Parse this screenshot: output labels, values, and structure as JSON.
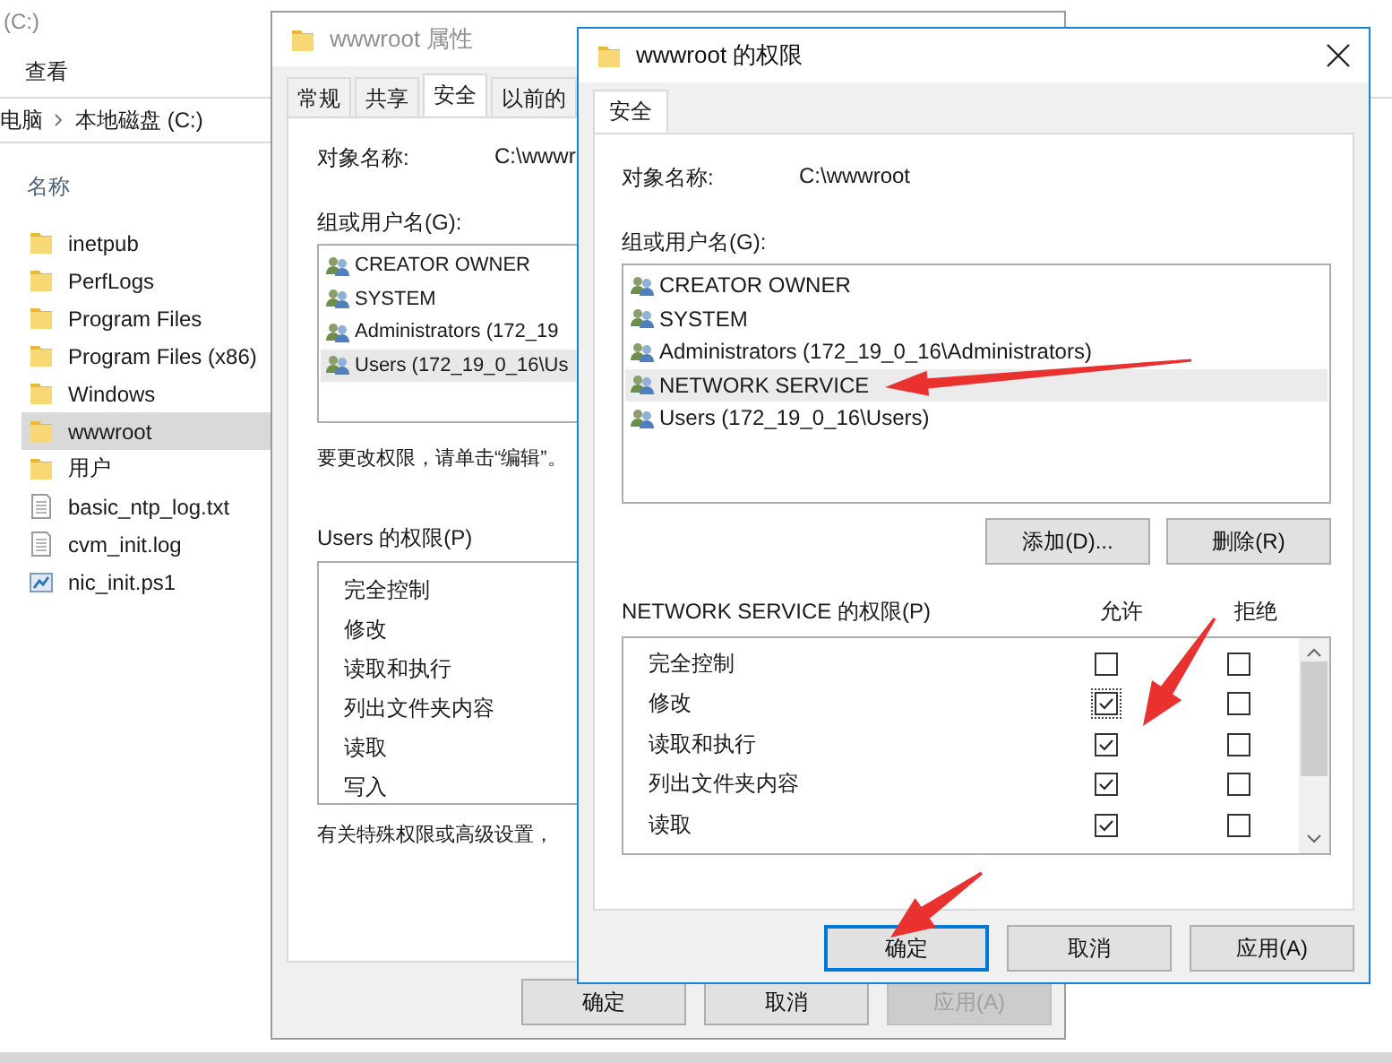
{
  "explorer": {
    "title": "(C:)",
    "ribbon_tabs": [
      {
        "label": "查看"
      }
    ],
    "breadcrumb": [
      "电脑",
      "本地磁盘 (C:)"
    ],
    "column_header": "名称",
    "items": [
      {
        "name": "inetpub",
        "kind": "folder",
        "selected": false
      },
      {
        "name": "PerfLogs",
        "kind": "folder",
        "selected": false
      },
      {
        "name": "Program Files",
        "kind": "folder",
        "selected": false
      },
      {
        "name": "Program Files (x86)",
        "kind": "folder",
        "selected": false
      },
      {
        "name": "Windows",
        "kind": "folder",
        "selected": false
      },
      {
        "name": "wwwroot",
        "kind": "folder",
        "selected": true
      },
      {
        "name": "用户",
        "kind": "folder",
        "selected": false
      },
      {
        "name": "basic_ntp_log.txt",
        "kind": "text",
        "selected": false
      },
      {
        "name": "cvm_init.log",
        "kind": "text",
        "selected": false
      },
      {
        "name": "nic_init.ps1",
        "kind": "script",
        "selected": false
      }
    ]
  },
  "properties_dialog": {
    "title": "wwwroot 属性",
    "tabs": [
      {
        "label": "常规",
        "selected": false
      },
      {
        "label": "共享",
        "selected": false
      },
      {
        "label": "安全",
        "selected": true
      },
      {
        "label": "以前的",
        "selected": false
      }
    ],
    "object_label": "对象名称:",
    "object_value": "C:\\wwwr",
    "groups_label": "组或用户名(G):",
    "groups": [
      {
        "name": "CREATOR OWNER",
        "selected": false
      },
      {
        "name": "SYSTEM",
        "selected": false
      },
      {
        "name": "Administrators (172_19",
        "selected": false
      },
      {
        "name": "Users (172_19_0_16\\Us",
        "selected": true
      }
    ],
    "edit_hint": "要更改权限，请单击“编辑”。",
    "permissions_label": "Users 的权限(P)",
    "permissions": [
      "完全控制",
      "修改",
      "读取和执行",
      "列出文件夹内容",
      "读取",
      "写入"
    ],
    "advanced_hint": "有关特殊权限或高级设置，",
    "buttons": [
      {
        "label": "确定",
        "disabled": false
      },
      {
        "label": "取消",
        "disabled": false
      },
      {
        "label": "应用(A)",
        "disabled": true
      }
    ]
  },
  "permissions_dialog": {
    "title": "wwwroot 的权限",
    "tabs": [
      {
        "label": "安全",
        "selected": true
      }
    ],
    "object_label": "对象名称:",
    "object_value": "C:\\wwwroot",
    "groups_label": "组或用户名(G):",
    "groups": [
      {
        "name": "CREATOR OWNER",
        "selected": false
      },
      {
        "name": "SYSTEM",
        "selected": false
      },
      {
        "name": "Administrators (172_19_0_16\\Administrators)",
        "selected": false
      },
      {
        "name": "NETWORK SERVICE",
        "selected": true
      },
      {
        "name": "Users (172_19_0_16\\Users)",
        "selected": false
      }
    ],
    "group_buttons": [
      {
        "label": "添加(D)..."
      },
      {
        "label": "删除(R)"
      }
    ],
    "permissions_label": "NETWORK SERVICE 的权限(P)",
    "allow_header": "允许",
    "deny_header": "拒绝",
    "permissions": [
      {
        "name": "完全控制",
        "allow": false,
        "deny": false,
        "focused": false
      },
      {
        "name": "修改",
        "allow": true,
        "deny": false,
        "focused": true
      },
      {
        "name": "读取和执行",
        "allow": true,
        "deny": false,
        "focused": false
      },
      {
        "name": "列出文件夹内容",
        "allow": true,
        "deny": false,
        "focused": false
      },
      {
        "name": "读取",
        "allow": true,
        "deny": false,
        "focused": false
      }
    ],
    "buttons": [
      {
        "label": "确定",
        "default": true,
        "disabled": false
      },
      {
        "label": "取消",
        "default": false,
        "disabled": false
      },
      {
        "label": "应用(A)",
        "default": false,
        "disabled": false
      }
    ]
  }
}
